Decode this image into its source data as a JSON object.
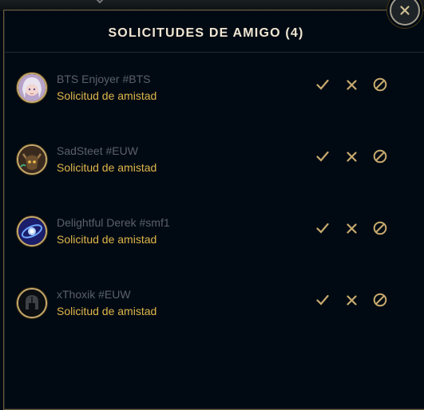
{
  "dialog": {
    "title": "SOLICITUDES DE AMIGO (4)",
    "close_icon": "close-icon"
  },
  "requests": [
    {
      "name": "BTS Enjoyer #BTS",
      "status": "Solicitud de amistad",
      "avatar_icon": "anime-girl-avatar"
    },
    {
      "name": "SadSteet #EUW",
      "status": "Solicitud de amistad",
      "avatar_icon": "demon-mask-avatar"
    },
    {
      "name": "Delightful Derek #smf1",
      "status": "Solicitud de amistad",
      "avatar_icon": "blue-vortex-avatar"
    },
    {
      "name": "xThoxik #EUW",
      "status": "Solicitud de amistad",
      "avatar_icon": "helmet-avatar"
    }
  ],
  "actions": {
    "accept_icon": "check-icon",
    "decline_icon": "x-icon",
    "block_icon": "block-icon"
  },
  "colors": {
    "background": "#010a13",
    "gold": "#c8aa6e",
    "status_text": "#e0b54a",
    "name_text": "#5c6068",
    "title_text": "#f0e6d2"
  }
}
